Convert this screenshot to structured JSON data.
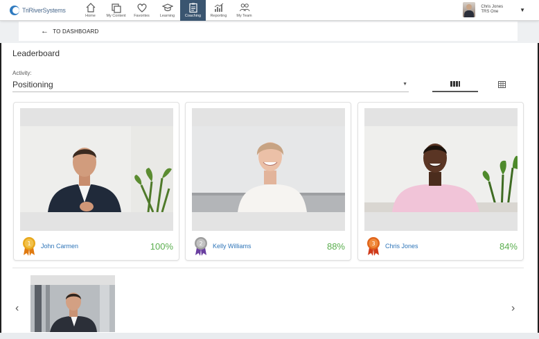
{
  "app": {
    "logo_text": "TriRiverSystems",
    "nav": [
      {
        "label": "Home",
        "icon": "home-icon"
      },
      {
        "label": "My Content",
        "icon": "content-icon"
      },
      {
        "label": "Favorites",
        "icon": "heart-icon"
      },
      {
        "label": "Learning",
        "icon": "graduation-cap-icon"
      },
      {
        "label": "Coaching",
        "icon": "clipboard-icon",
        "active": true
      },
      {
        "label": "Reporting",
        "icon": "bar-chart-icon"
      },
      {
        "label": "My Team",
        "icon": "team-icon"
      }
    ],
    "user": {
      "name": "Chris Jones",
      "org": "TRS One"
    }
  },
  "back": {
    "label": "TO DASHBOARD"
  },
  "page": {
    "title": "Leaderboard",
    "activity_label": "Activity:",
    "activity_value": "Positioning"
  },
  "cards": [
    {
      "name": "John Carmen",
      "score": "100%",
      "rank": "1",
      "medal_color": "#e8a81c",
      "ribbon_color": "#e07a10"
    },
    {
      "name": "Kelly Williams",
      "score": "88%",
      "rank": "2",
      "medal_color": "#9e9e9e",
      "ribbon_color": "#6a3fa0"
    },
    {
      "name": "Chris Jones",
      "score": "84%",
      "rank": "3",
      "medal_color": "#e0651c",
      "ribbon_color": "#cf3a1a"
    }
  ],
  "colors": {
    "accent": "#2d74b8",
    "score": "#5aae4e",
    "nav_active": "#3a5570"
  }
}
